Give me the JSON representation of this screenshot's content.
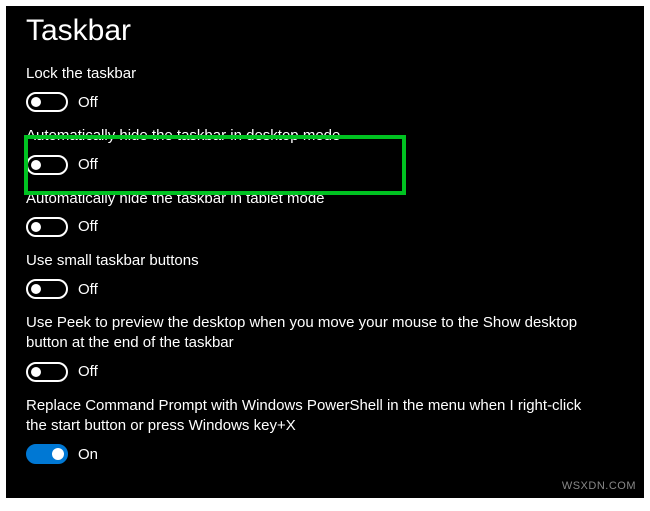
{
  "title": "Taskbar",
  "settings": {
    "lock": {
      "label": "Lock the taskbar",
      "state": "Off",
      "on": false
    },
    "hideDesktop": {
      "label": "Automatically hide the taskbar in desktop mode",
      "state": "Off",
      "on": false
    },
    "hideTablet": {
      "label": "Automatically hide the taskbar in tablet mode",
      "state": "Off",
      "on": false
    },
    "smallButtons": {
      "label": "Use small taskbar buttons",
      "state": "Off",
      "on": false
    },
    "peek": {
      "label": "Use Peek to preview the desktop when you move your mouse to the Show desktop button at the end of the taskbar",
      "state": "Off",
      "on": false
    },
    "powershell": {
      "label": "Replace Command Prompt with Windows PowerShell in the menu when I right-click the start button or press Windows key+X",
      "state": "On",
      "on": true
    }
  },
  "watermark": "WSXDN.COM"
}
